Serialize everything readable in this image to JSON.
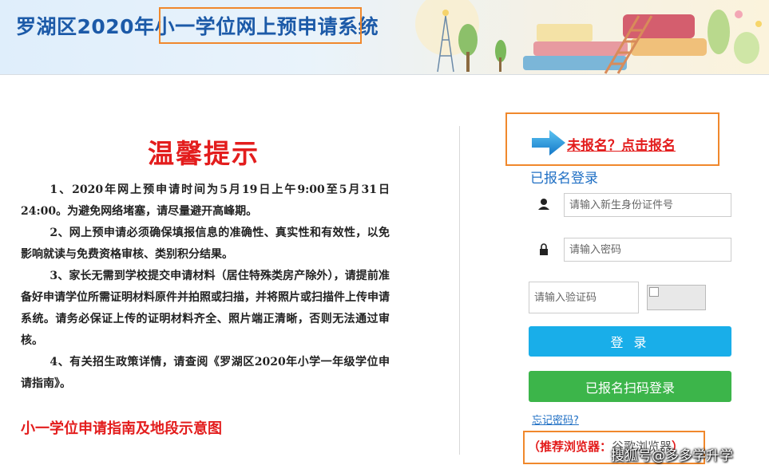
{
  "header": {
    "title_prefix": "罗湖区2020年",
    "title_highlight": "小一学位网上预申请",
    "title_suffix": "系统"
  },
  "notice": {
    "title": "温馨提示",
    "paragraphs": [
      "1、2020年网上预申请时间为5月19日上午9:00至5月31日24:00。为避免网络堵塞，请尽量避开高峰期。",
      "2、网上预申请必须确保填报信息的准确性、真实性和有效性，以免影响就读与免费资格审核、类别积分结果。",
      "3、家长无需到学校提交申请材料（居住特殊类房产除外），请提前准备好申请学位所需证明材料原件并拍照或扫描，并将照片或扫描件上传申请系统。请务必保证上传的证明材料齐全、照片端正清晰，否则无法通过审核。",
      "4、有关招生政策详情，请查阅《罗湖区2020年小学一年级学位申请指南》。"
    ],
    "guide_link": "小一学位申请指南及地段示意图"
  },
  "login": {
    "register_link": "未报名？点击报名",
    "title": "已报名登录",
    "id_placeholder": "请输入新生身份证件号",
    "password_placeholder": "请输入密码",
    "captcha_placeholder": "请输入验证码",
    "login_button": "登 录",
    "qr_button": "已报名扫码登录",
    "forgot_link": "忘记密码?",
    "browser_label": "（推荐浏览器：",
    "browser_name": "谷歌浏览器",
    "browser_end": "）"
  },
  "watermark": "搜狐号@多多学升学",
  "colors": {
    "title_blue": "#1c5aa8",
    "alert_red": "#e31d1d",
    "highlight_orange": "#f0882c",
    "login_blue": "#19aee9",
    "qr_green": "#3cb54a",
    "link_blue": "#1f6fc4"
  },
  "icons": [
    "user-icon",
    "lock-icon",
    "arrow-right-icon",
    "captcha-image-icon"
  ]
}
